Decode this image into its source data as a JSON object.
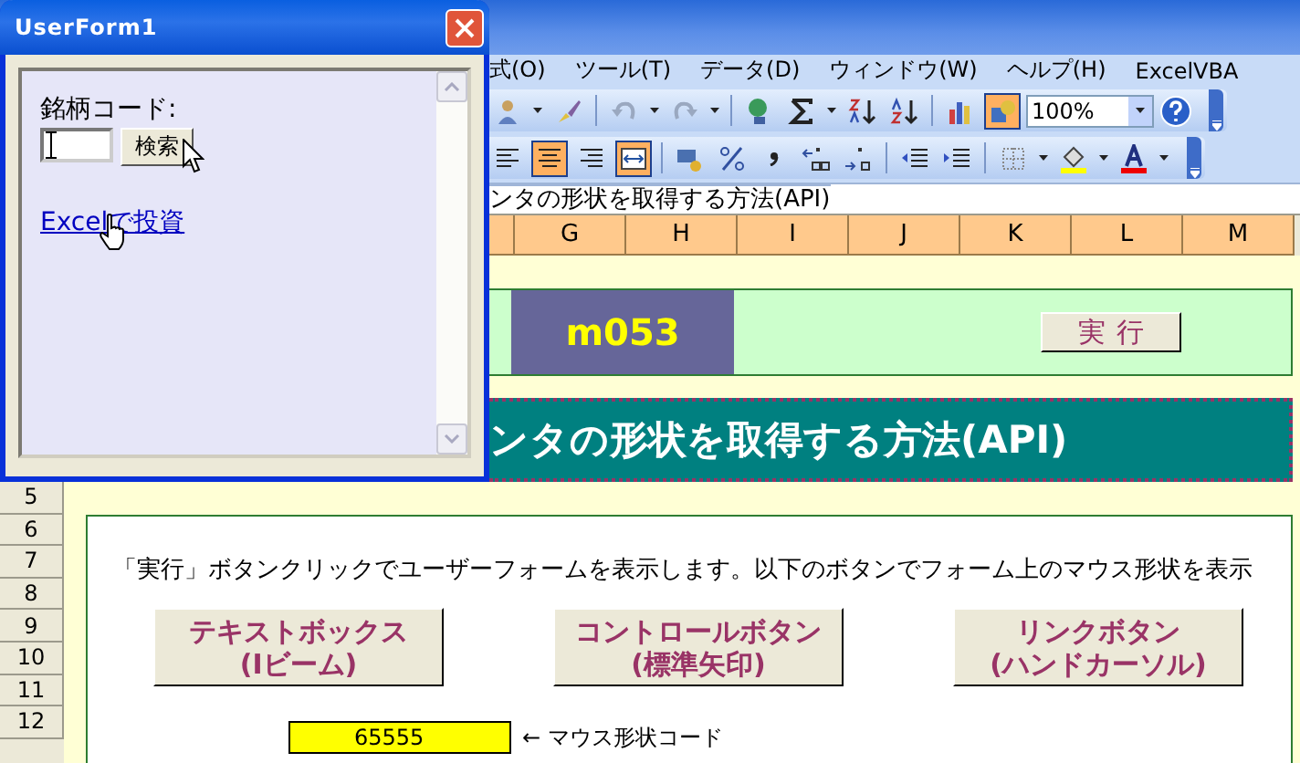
{
  "excel": {
    "menu": [
      "式(O)",
      "ツール(T)",
      "データ(D)",
      "ウィンドウ(W)",
      "ヘルプ(H)",
      "ExcelVBA"
    ],
    "toolbar_1": [
      {
        "kind": "person",
        "on": false
      },
      {
        "kind": "dropdown"
      },
      {
        "kind": "brush",
        "on": false
      },
      {
        "kind": "separator"
      },
      {
        "kind": "undo",
        "on": false
      },
      {
        "kind": "dropdown"
      },
      {
        "kind": "redo",
        "on": false
      },
      {
        "kind": "dropdown"
      },
      {
        "kind": "separator"
      },
      {
        "kind": "hyperlink",
        "on": false
      },
      {
        "kind": "sum",
        "on": false
      },
      {
        "kind": "dropdown"
      },
      {
        "kind": "sort_asc",
        "on": false
      },
      {
        "kind": "sort_desc",
        "on": false
      },
      {
        "kind": "separator"
      },
      {
        "kind": "chart",
        "on": false
      },
      {
        "kind": "drawing",
        "on": true
      }
    ],
    "zoom": "100%",
    "toolbar_2": [
      {
        "kind": "align_left",
        "on": false
      },
      {
        "kind": "align_center",
        "on": true
      },
      {
        "kind": "align_right",
        "on": false
      },
      {
        "kind": "merge",
        "on": true
      },
      {
        "kind": "separator"
      },
      {
        "kind": "currency",
        "on": false
      },
      {
        "kind": "percent",
        "on": false
      },
      {
        "kind": "comma",
        "on": false
      },
      {
        "kind": "inc_decimal",
        "on": false
      },
      {
        "kind": "dec_decimal",
        "on": false
      },
      {
        "kind": "separator"
      },
      {
        "kind": "outdent",
        "on": false
      },
      {
        "kind": "indent",
        "on": false
      },
      {
        "kind": "separator"
      },
      {
        "kind": "borders",
        "on": false
      },
      {
        "kind": "dropdown"
      },
      {
        "kind": "fill",
        "on": false
      },
      {
        "kind": "dropdown"
      },
      {
        "kind": "font_color",
        "on": false
      },
      {
        "kind": "dropdown"
      }
    ],
    "formula": "ンタの形状を取得する方法(API)",
    "columns": [
      "G",
      "H",
      "I",
      "J",
      "K",
      "L",
      "M"
    ],
    "sheet": {
      "code": "m053",
      "run_button": "実行",
      "banner": "ンタの形状を取得する方法(API)",
      "rows": [
        "5",
        "6",
        "7",
        "8",
        "9",
        "10",
        "11",
        "12"
      ],
      "description": "「実行」ボタンクリックでユーザーフォームを表示します。以下のボタンでフォーム上のマウス形状を表示",
      "buttons": [
        "テキストボックス\n(Iビーム)",
        "コントロールボタン\n(標準矢印)",
        "リンクボタン\n(ハンドカーソル)"
      ],
      "code_cell": "65555",
      "code_label": "← マウス形状コード"
    }
  },
  "userform": {
    "title": "UserForm1",
    "label": "銘柄コード:",
    "button": "検索",
    "link": "Excelで投資"
  }
}
